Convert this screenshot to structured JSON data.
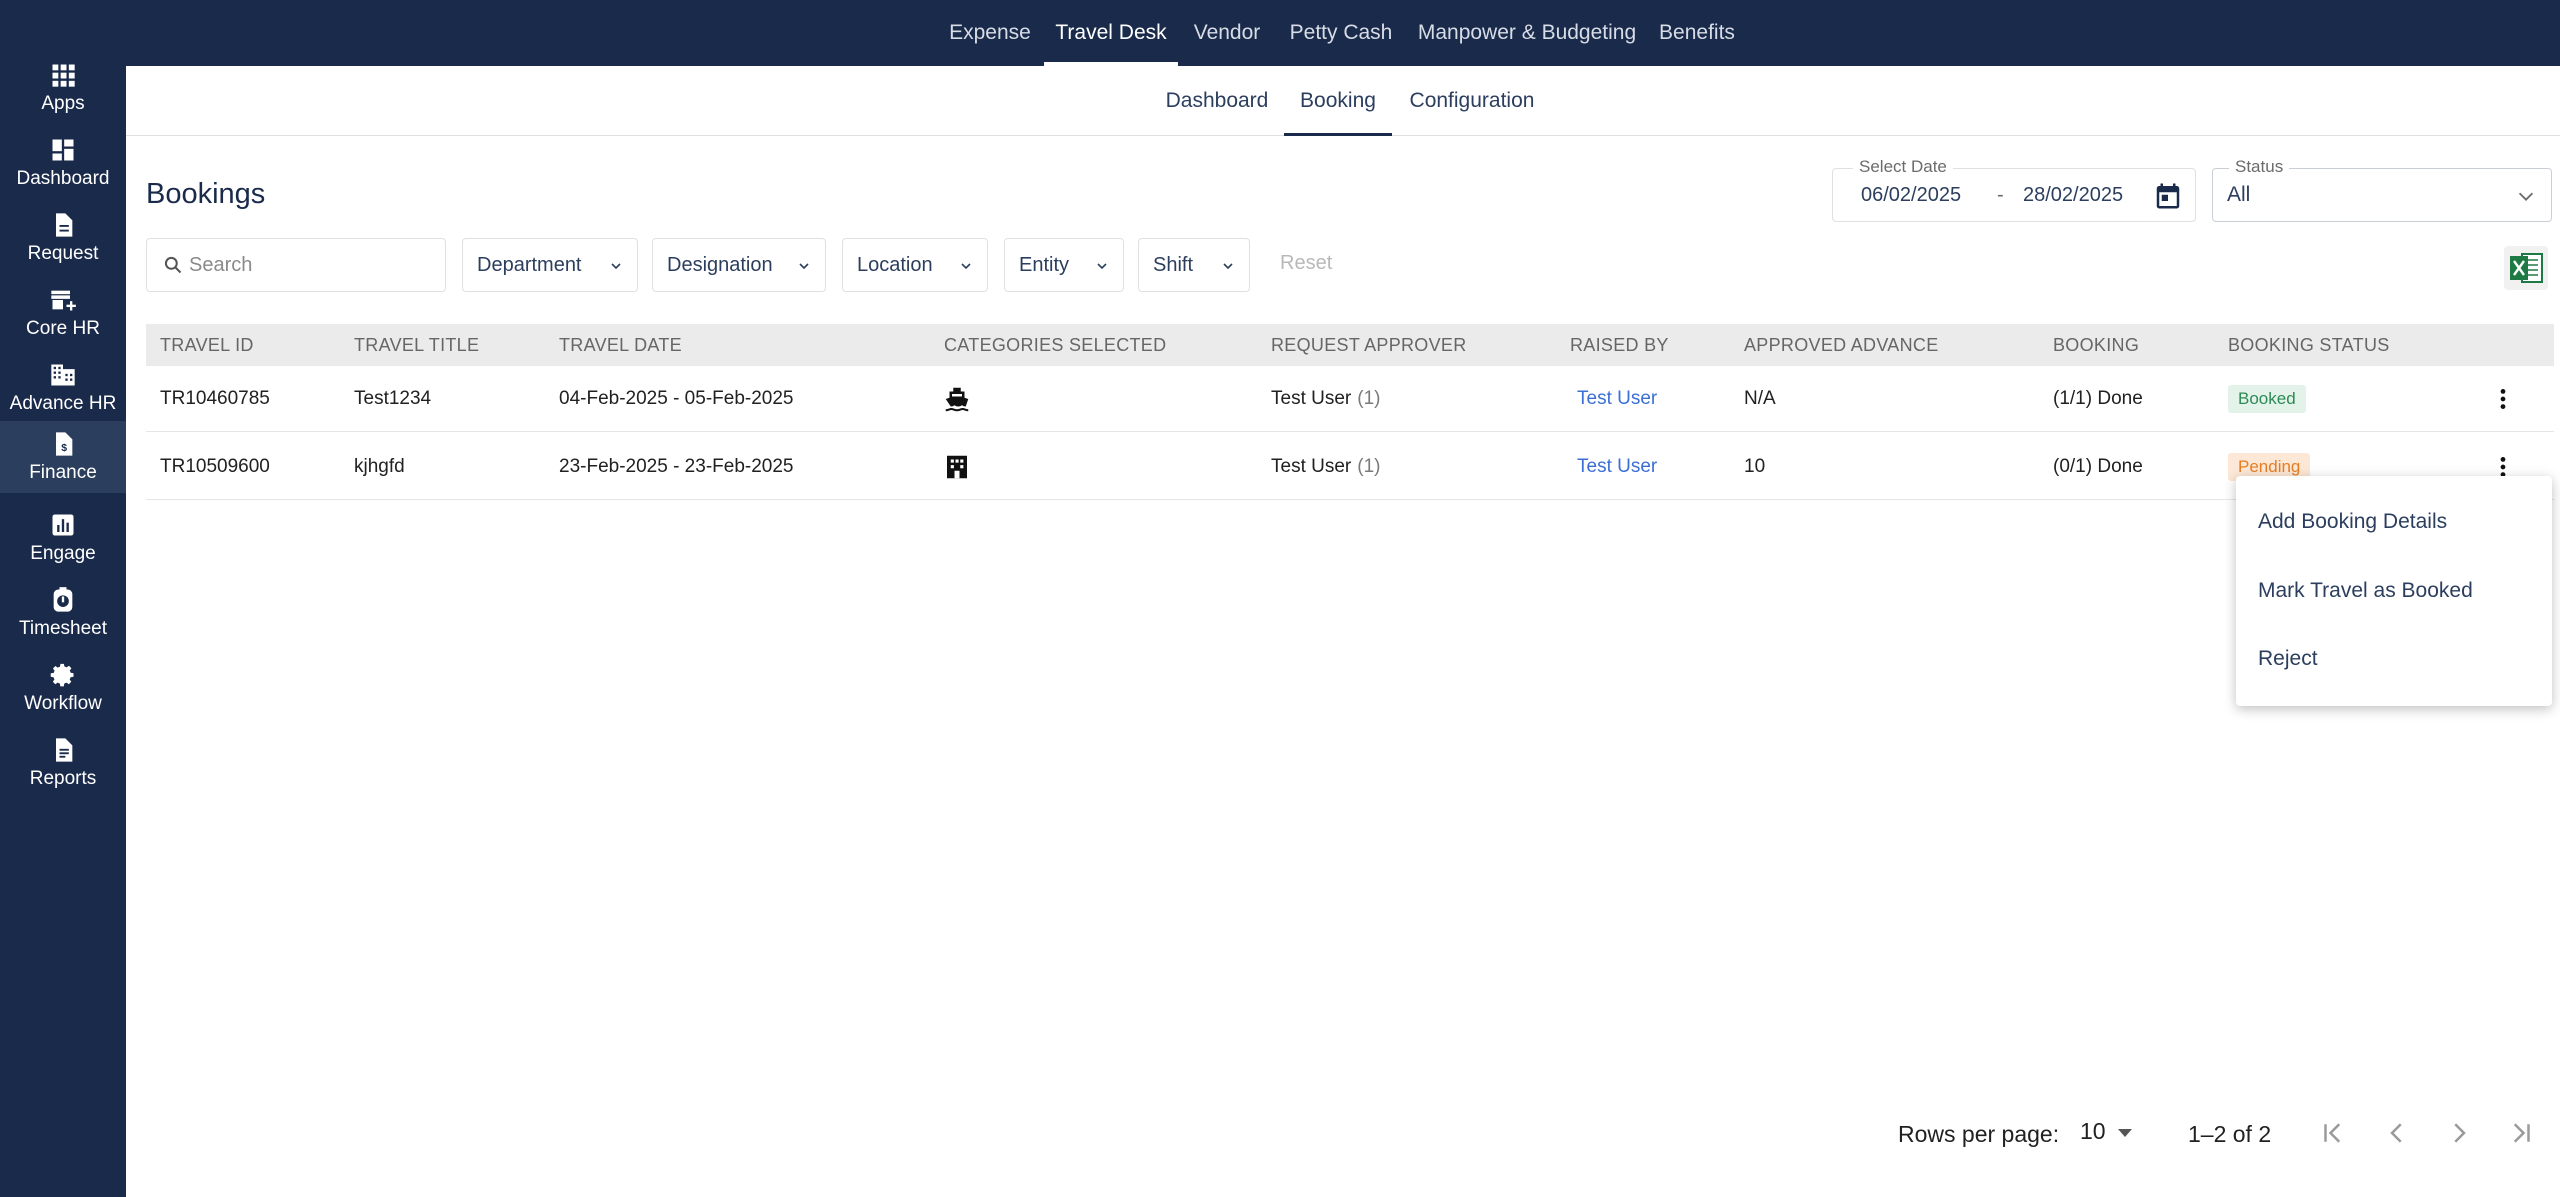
{
  "sidebar": {
    "items": [
      {
        "label": "Apps",
        "icon": "apps-grid-icon"
      },
      {
        "label": "Dashboard",
        "icon": "dashboard-icon"
      },
      {
        "label": "Request",
        "icon": "document-icon"
      },
      {
        "label": "Core HR",
        "icon": "store-icon"
      },
      {
        "label": "Advance HR",
        "icon": "building-icon"
      },
      {
        "label": "Finance",
        "icon": "finance-icon"
      },
      {
        "label": "Engage",
        "icon": "bar-chart-icon"
      },
      {
        "label": "Timesheet",
        "icon": "stopwatch-icon"
      },
      {
        "label": "Workflow",
        "icon": "gear-icon"
      },
      {
        "label": "Reports",
        "icon": "report-icon"
      }
    ],
    "active": "Finance"
  },
  "topnav": {
    "tabs": [
      "Expense",
      "Travel Desk",
      "Vendor",
      "Petty Cash",
      "Manpower & Budgeting",
      "Benefits"
    ],
    "active": "Travel Desk"
  },
  "subnav": {
    "tabs": [
      "Dashboard",
      "Booking",
      "Configuration"
    ],
    "active": "Booking"
  },
  "page": {
    "title": "Bookings"
  },
  "date_filter": {
    "label": "Select Date",
    "from": "06/02/2025",
    "separator": "-",
    "to": "28/02/2025"
  },
  "status_filter": {
    "label": "Status",
    "value": "All"
  },
  "filters": {
    "search_placeholder": "Search",
    "department": "Department",
    "designation": "Designation",
    "location": "Location",
    "entity": "Entity",
    "shift": "Shift",
    "reset": "Reset"
  },
  "table": {
    "columns": [
      "TRAVEL ID",
      "TRAVEL TITLE",
      "TRAVEL DATE",
      "CATEGORIES SELECTED",
      "REQUEST APPROVER",
      "RAISED BY",
      "APPROVED ADVANCE",
      "BOOKING",
      "BOOKING STATUS"
    ],
    "rows": [
      {
        "travel_id": "TR10460785",
        "title": "Test1234",
        "date": "04-Feb-2025 - 05-Feb-2025",
        "category_icon": "ship-icon",
        "approver": "Test User",
        "approver_count": "(1)",
        "raised_by": "Test User",
        "advance": "N/A",
        "booking": "(1/1) Done",
        "status": "Booked"
      },
      {
        "travel_id": "TR10509600",
        "title": "kjhgfd",
        "date": "23-Feb-2025 - 23-Feb-2025",
        "category_icon": "hotel-icon",
        "approver": "Test User",
        "approver_count": "(1)",
        "raised_by": "Test User",
        "advance": "10",
        "booking": "(0/1) Done",
        "status": "Pending"
      }
    ]
  },
  "row_menu": {
    "items": [
      "Add Booking Details",
      "Mark Travel as Booked",
      "Reject"
    ]
  },
  "pagination": {
    "rows_label": "Rows per page:",
    "rows_value": "10",
    "range": "1–2 of 2"
  },
  "colors": {
    "nav_bg": "#1a2a4a",
    "link": "#3b6fd6",
    "booked_text": "#2e8a55",
    "pending_text": "#e67e22"
  }
}
